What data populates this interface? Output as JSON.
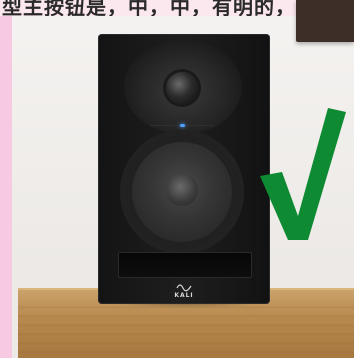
{
  "header": {
    "partial_caption": "型主按钮是，中，中，有明的，有明"
  },
  "product": {
    "brand_logo_text": "KALI",
    "led_color": "#4ea0ff",
    "body_color": "#141414"
  },
  "overlay": {
    "checkmark_icon": "check-mark-icon",
    "checkmark_color": "#0e8a33"
  }
}
